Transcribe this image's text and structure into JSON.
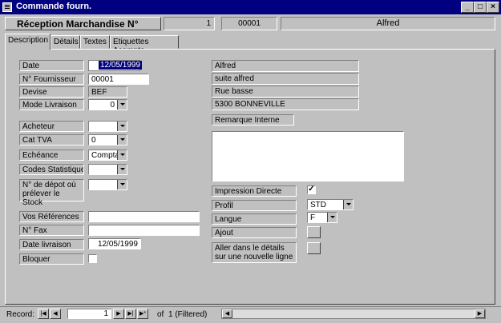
{
  "window": {
    "title": "Commande fourn."
  },
  "header": {
    "title": "Réception Marchandise N°",
    "number": "1",
    "code": "00001",
    "supplier_name": "Alfred"
  },
  "tabs": [
    {
      "label": "Description",
      "active": true
    },
    {
      "label": "Détails",
      "active": false
    },
    {
      "label": "Textes",
      "active": false
    },
    {
      "label": "Etiquettes Acompte",
      "active": false
    }
  ],
  "form": {
    "date": {
      "label": "Date",
      "value": "12/05/1999"
    },
    "fournisseur": {
      "label": "N° Fournisseur",
      "value": "00001"
    },
    "devise": {
      "label": "Devise",
      "value": "BEF"
    },
    "mode_livraison": {
      "label": "Mode Livraison",
      "value": "0"
    },
    "acheteur": {
      "label": "Acheteur",
      "value": ""
    },
    "cat_tva": {
      "label": "Cat TVA",
      "value": "0"
    },
    "echeance": {
      "label": "Echéance",
      "value": "Compta"
    },
    "codes_stat": {
      "label": "Codes Statistiques",
      "value": ""
    },
    "depot": {
      "label": "N° de dépot où prélever le Stock",
      "value": ""
    },
    "vos_references": {
      "label": "Vos Références",
      "value": ""
    },
    "fax": {
      "label": "N° Fax",
      "value": ""
    },
    "date_livraison": {
      "label": "Date livraison",
      "value": "12/05/1999"
    },
    "bloquer": {
      "label": "Bloquer",
      "checked": false
    }
  },
  "address": {
    "line1": "Alfred",
    "line2": "suite alfred",
    "line3": "Rue basse",
    "line4": "5300  BONNEVILLE"
  },
  "remarks": {
    "label": "Remarque Interne",
    "value": ""
  },
  "options": {
    "impression_directe": {
      "label": "Impression Directe",
      "checked": true,
      "mark": "✓"
    },
    "profil": {
      "label": "Profil",
      "value": "STD"
    },
    "langue": {
      "label": "Langue",
      "value": "F"
    },
    "ajout": {
      "label": "Ajout"
    },
    "aller_details": {
      "label": "Aller dans le détails sur une nouvelle ligne"
    }
  },
  "record_nav": {
    "label": "Record:",
    "current": "1",
    "of_label": "of",
    "total": "1 (Filtered)"
  }
}
